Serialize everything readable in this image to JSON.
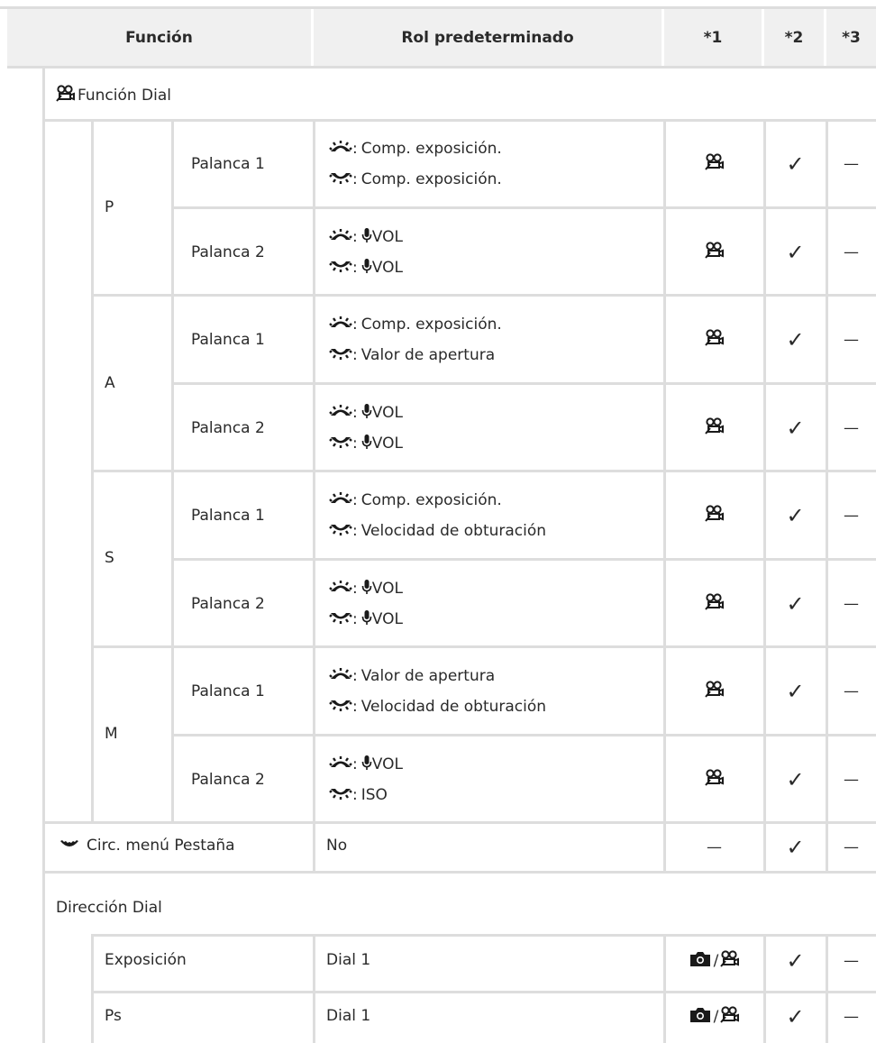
{
  "table": {
    "headers": [
      "Función",
      "Rol predeterminado",
      "*1",
      "*2",
      "*3"
    ],
    "sections": {
      "funcion_dial": "Función Dial",
      "circ_menu": "Circ. menú Pestaña",
      "circ_menu_default": "No",
      "direccion_dial": "Dirección Dial"
    },
    "modes": [
      "P",
      "A",
      "S",
      "M"
    ],
    "rows": [
      {
        "lever": "Palanca 1",
        "front": "Comp. exposición.",
        "rear": "Comp. exposición.",
        "c1": "movie",
        "c2": "✓",
        "c3": "—"
      },
      {
        "lever": "Palanca 2",
        "front": "VOL",
        "rear": "VOL",
        "c1": "movie",
        "c2": "✓",
        "c3": "—"
      },
      {
        "lever": "Palanca 1",
        "front": "Comp. exposición.",
        "rear": "Valor de apertura",
        "c1": "movie",
        "c2": "✓",
        "c3": "—"
      },
      {
        "lever": "Palanca 2",
        "front": "VOL",
        "rear": "VOL",
        "c1": "movie",
        "c2": "✓",
        "c3": "—"
      },
      {
        "lever": "Palanca 1",
        "front": "Comp. exposición.",
        "rear": "Velocidad de obturación",
        "c1": "movie",
        "c2": "✓",
        "c3": "—"
      },
      {
        "lever": "Palanca 2",
        "front": "VOL",
        "rear": "VOL",
        "c1": "movie",
        "c2": "✓",
        "c3": "—"
      },
      {
        "lever": "Palanca 1",
        "front": "Valor de apertura",
        "rear": "Velocidad de obturación",
        "c1": "movie",
        "c2": "✓",
        "c3": "—"
      },
      {
        "lever": "Palanca 2",
        "front": "VOL",
        "rear": "ISO",
        "c1": "movie",
        "c2": "✓",
        "c3": "—"
      }
    ],
    "circ_row": {
      "c1": "—",
      "c2": "✓",
      "c3": "—"
    },
    "dir_rows": [
      {
        "name": "Exposición",
        "value": "Dial 1",
        "c1": "camera/movie",
        "c2": "✓",
        "c3": "—"
      },
      {
        "name": "Ps",
        "value": "Dial 1",
        "c1": "camera/movie",
        "c2": "✓",
        "c3": "—"
      }
    ]
  },
  "icons": {
    "front_dial": "front-dial-icon",
    "rear_dial": "rear-dial-icon",
    "mic": "mic-icon",
    "movie": "movie-mode-icon",
    "camera": "camera-icon",
    "tab_dial": "tab-dial-icon"
  },
  "colors": {
    "header_bg": "#f0f0f0",
    "line": "#dddddd",
    "text": "#2a2a2a"
  }
}
